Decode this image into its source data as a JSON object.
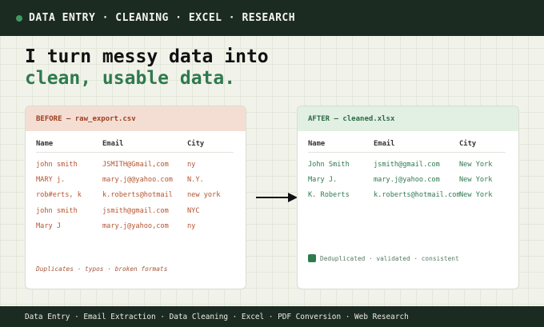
{
  "header": {
    "title": "DATA ENTRY · CLEANING · EXCEL · RESEARCH"
  },
  "headline": {
    "line1": "I turn messy data into",
    "line2": "clean, usable data."
  },
  "before": {
    "title": "BEFORE — raw_export.csv",
    "columns": [
      "Name",
      "Email",
      "City"
    ],
    "rows": [
      [
        "john smith",
        "JSMITH@Gmail,com",
        "ny"
      ],
      [
        "MARY j.",
        "mary.j@@yahoo.com",
        "N.Y."
      ],
      [
        "rob#erts, k",
        "k.roberts@hotmail",
        "new york"
      ],
      [
        "john smith",
        "jsmith@gmail.com",
        "NYC"
      ],
      [
        "Mary J",
        "mary.j@yahoo,com",
        "ny"
      ]
    ],
    "footer": "Duplicates · typos · broken formats"
  },
  "after": {
    "title": "AFTER — cleaned.xlsx",
    "columns": [
      "Name",
      "Email",
      "City"
    ],
    "rows": [
      [
        "John Smith",
        "jsmith@gmail.com",
        "New York"
      ],
      [
        "Mary J.",
        "mary.j@yahoo.com",
        "New York"
      ],
      [
        "K. Roberts",
        "k.roberts@hotmail.com",
        "New York"
      ]
    ],
    "footer": "Deduplicated · validated · consistent"
  },
  "footer_bar": {
    "text": "Data Entry · Email Extraction · Data Cleaning · Excel · PDF Conversion · Web Research"
  },
  "colors": {
    "dark": "#1c2b22",
    "accent_green": "#2f7a4f",
    "error_red": "#b4542f"
  },
  "icons": {
    "status_dot": "status-dot-icon",
    "arrow": "arrow-right-icon",
    "check_square": "square-icon"
  }
}
